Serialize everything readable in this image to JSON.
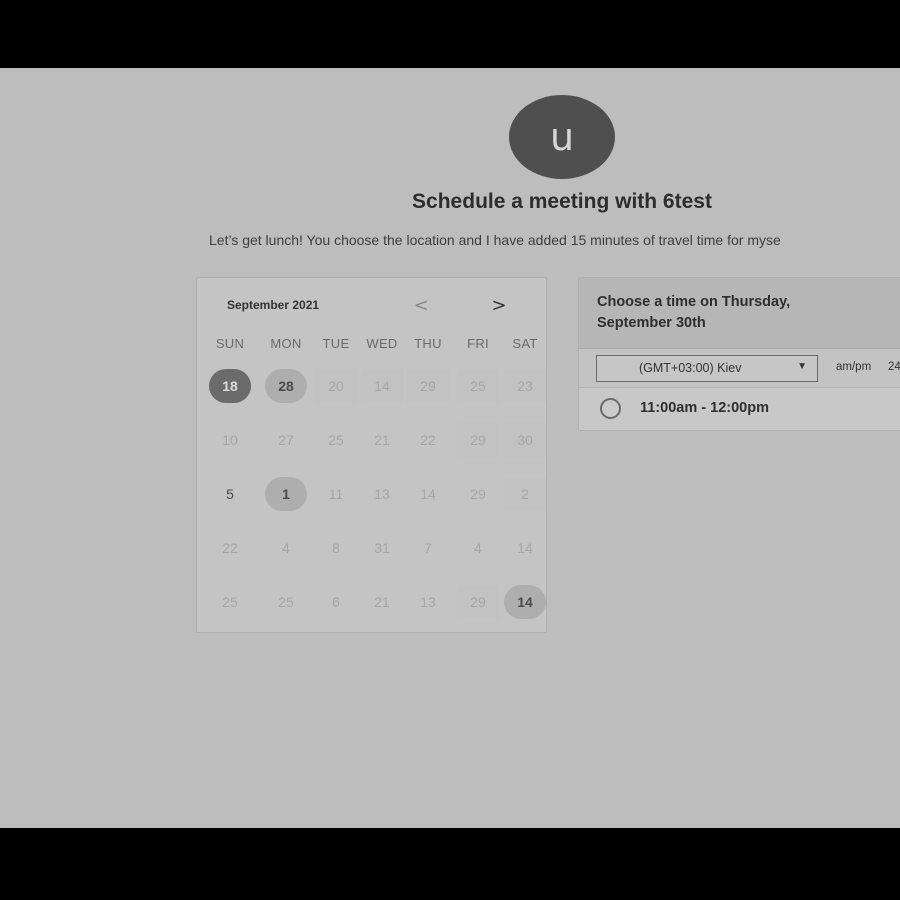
{
  "host": {
    "avatar_initial": "u",
    "title": "Schedule a meeting with 6test",
    "description": "Let’s get lunch! You choose the location and I have added 15 minutes of travel time for myse"
  },
  "calendar": {
    "month_label": "September 2021",
    "prev_icon": "<",
    "next_icon": ">",
    "weekdays": [
      "SUN",
      "MON",
      "TUE",
      "WED",
      "THU",
      "FRI",
      "SAT"
    ],
    "weeks": [
      [
        "18",
        "28",
        "20",
        "14",
        "29",
        "25",
        "23"
      ],
      [
        "10",
        "27",
        "25",
        "21",
        "22",
        "29",
        "30"
      ],
      [
        "5",
        "1",
        "11",
        "13",
        "14",
        "29",
        "2"
      ],
      [
        "22",
        "4",
        "8",
        "31",
        "7",
        "4",
        "14"
      ],
      [
        "25",
        "25",
        "6",
        "21",
        "13",
        "29",
        "14"
      ]
    ],
    "selected_day": "18"
  },
  "time_picker": {
    "heading": "Choose a time on Thursday, September 30th",
    "timezone": "(GMT+03:00) Kiev",
    "format_ampm": "am/pm",
    "format_24": "24",
    "slots": [
      "11:00am - 12:00pm"
    ]
  }
}
